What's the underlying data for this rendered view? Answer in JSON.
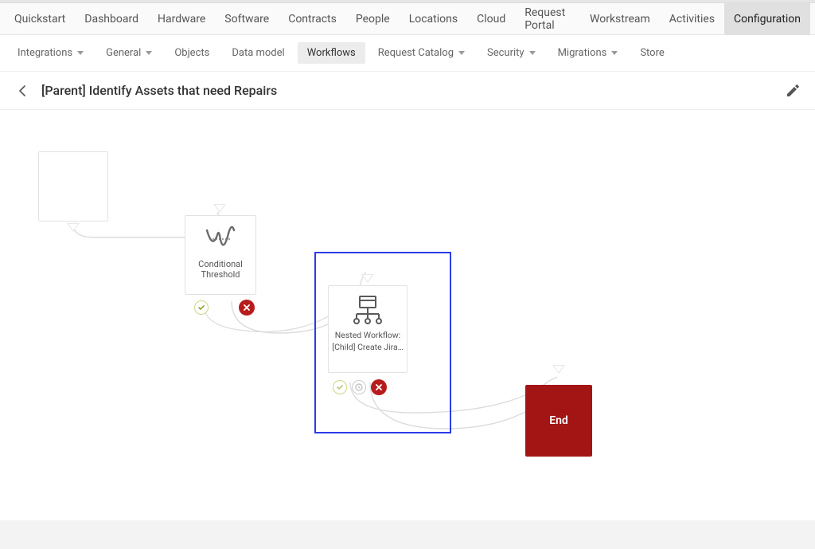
{
  "mainnav": {
    "items": [
      {
        "label": "Quickstart"
      },
      {
        "label": "Dashboard"
      },
      {
        "label": "Hardware"
      },
      {
        "label": "Software"
      },
      {
        "label": "Contracts"
      },
      {
        "label": "People"
      },
      {
        "label": "Locations"
      },
      {
        "label": "Cloud"
      },
      {
        "label": "Request Portal"
      },
      {
        "label": "Workstream"
      },
      {
        "label": "Activities"
      },
      {
        "label": "Configuration"
      }
    ],
    "active": 11
  },
  "subnav": {
    "items": [
      {
        "label": "Integrations",
        "dropdown": true
      },
      {
        "label": "General",
        "dropdown": true
      },
      {
        "label": "Objects",
        "dropdown": false
      },
      {
        "label": "Data model",
        "dropdown": false
      },
      {
        "label": "Workflows",
        "dropdown": false
      },
      {
        "label": "Request Catalog",
        "dropdown": true
      },
      {
        "label": "Security",
        "dropdown": true
      },
      {
        "label": "Migrations",
        "dropdown": true
      },
      {
        "label": "Store",
        "dropdown": false
      }
    ],
    "active": 4
  },
  "page": {
    "title": "[Parent] Identify Assets that need Repairs"
  },
  "nodes": {
    "conditional": {
      "label": "Conditional\nThreshold"
    },
    "nested": {
      "title": "Nested Workflow:",
      "subtitle": "[Child] Create Jira…"
    },
    "end": {
      "label": "End"
    }
  },
  "colors": {
    "selection": "#2b3be8",
    "danger": "#b71c1c",
    "endblock": "#a31515"
  }
}
